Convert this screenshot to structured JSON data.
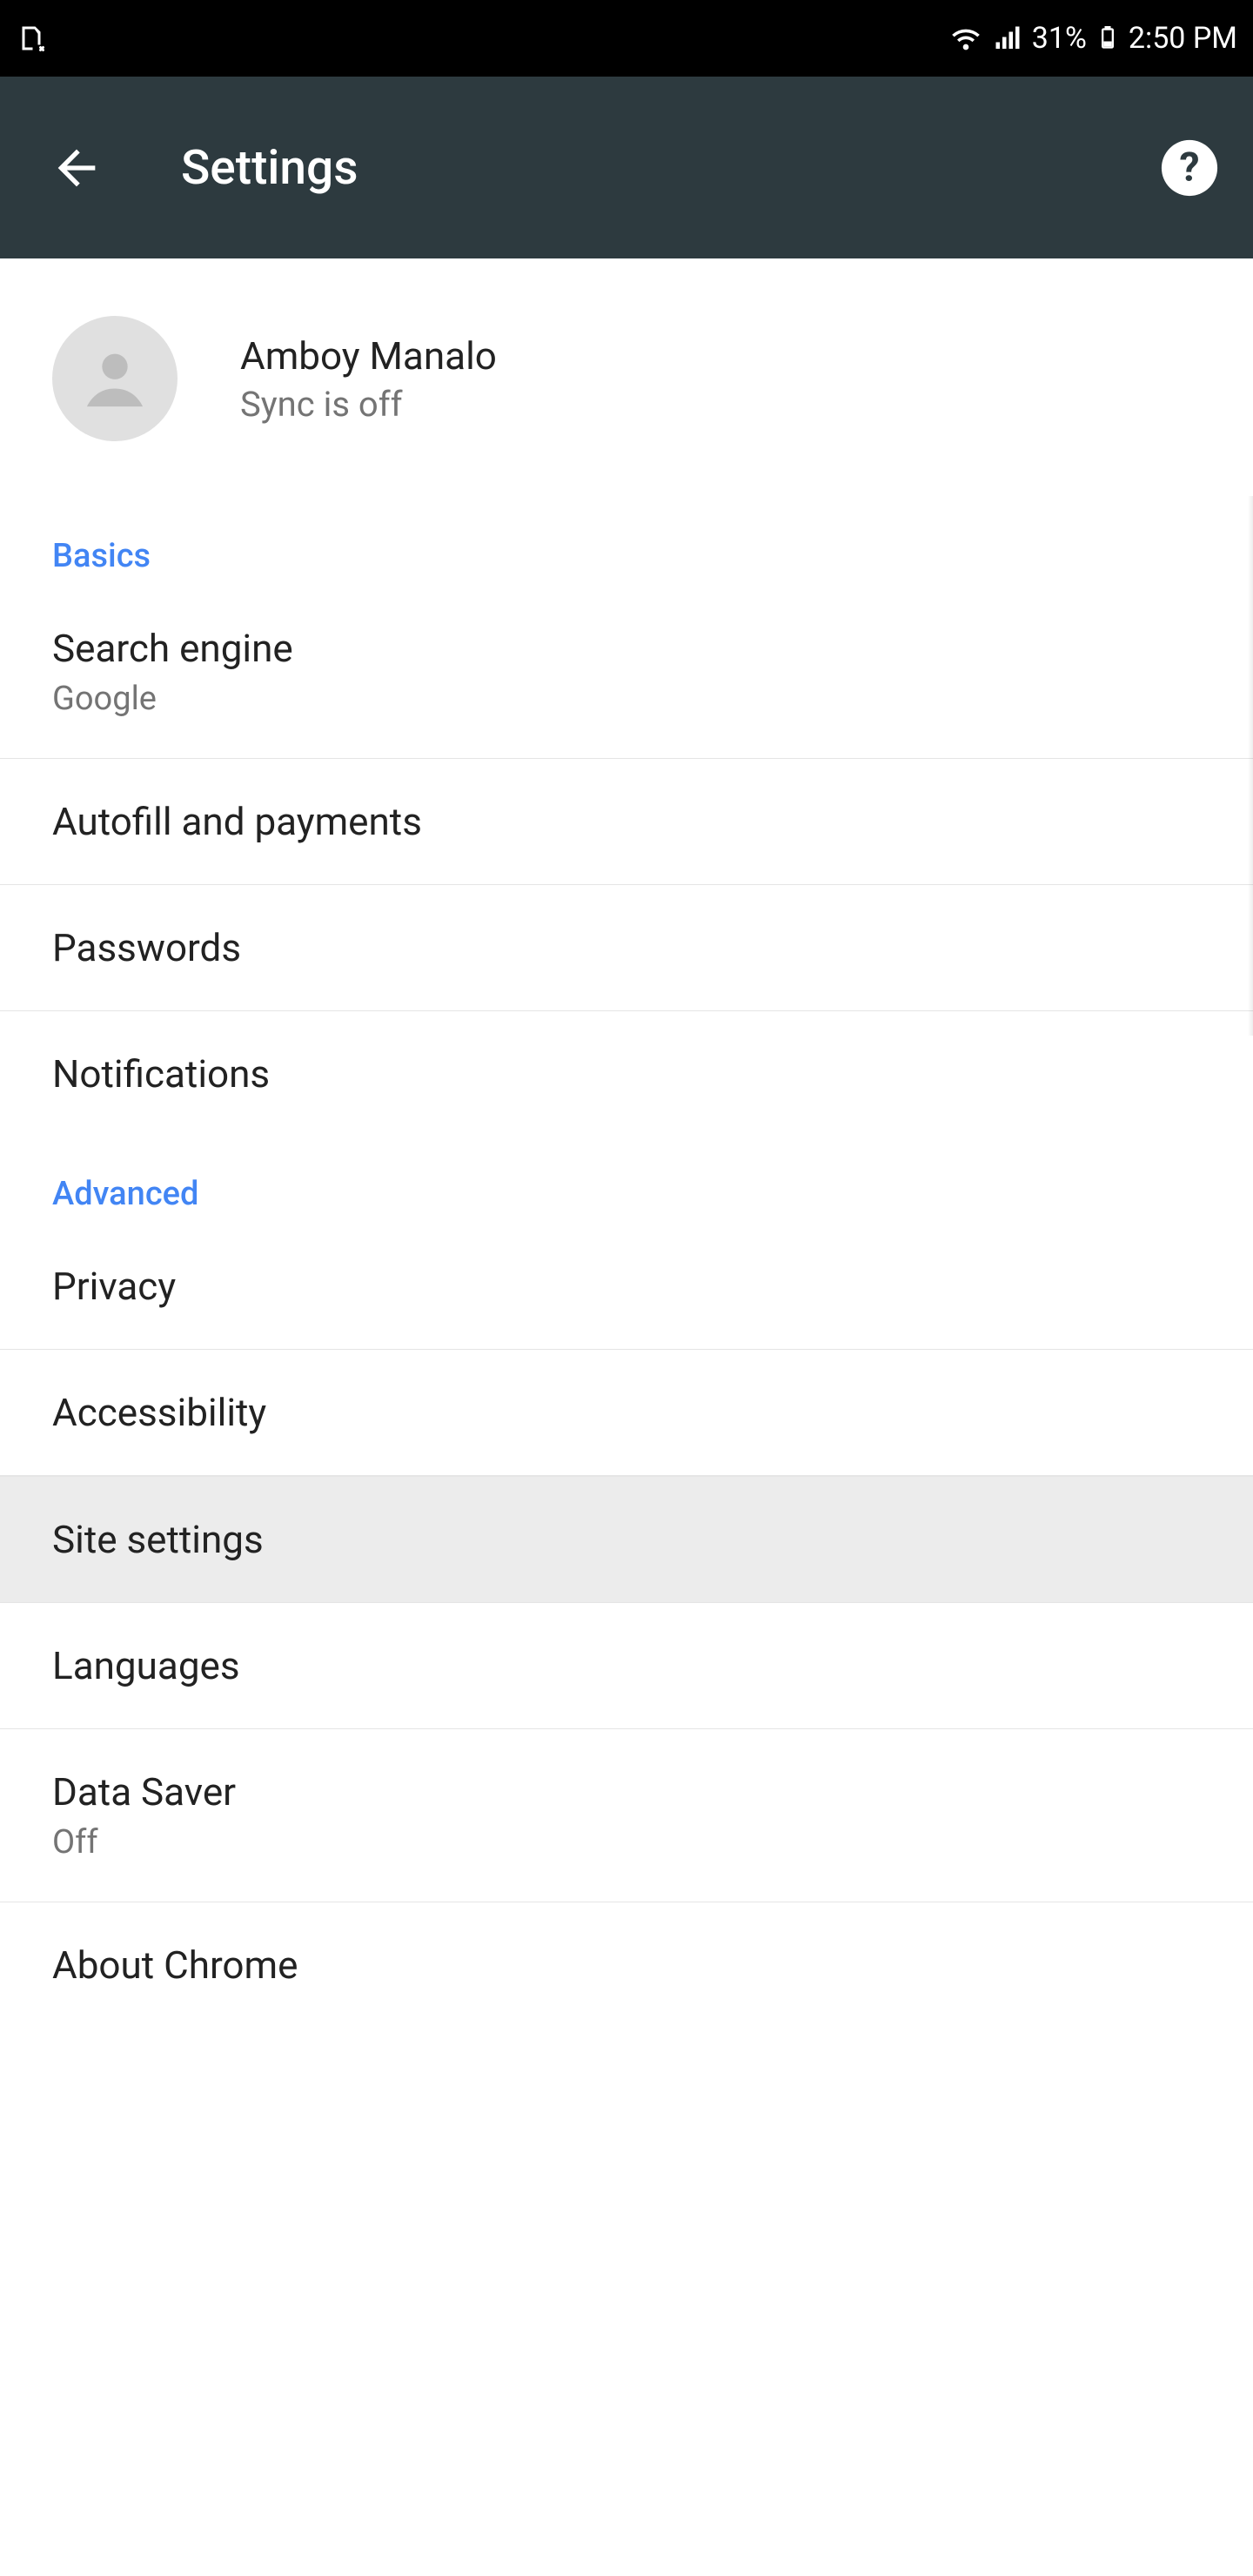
{
  "status": {
    "battery": "31%",
    "time": "2:50 PM"
  },
  "appbar": {
    "title": "Settings"
  },
  "account": {
    "name": "Amboy Manalo",
    "sync": "Sync is off"
  },
  "sections": {
    "basics": {
      "label": "Basics",
      "items": {
        "search_engine": {
          "title": "Search engine",
          "sub": "Google"
        },
        "autofill": {
          "title": "Autofill and payments"
        },
        "passwords": {
          "title": "Passwords"
        },
        "notifications": {
          "title": "Notifications"
        }
      }
    },
    "advanced": {
      "label": "Advanced",
      "items": {
        "privacy": {
          "title": "Privacy"
        },
        "accessibility": {
          "title": "Accessibility"
        },
        "site_settings": {
          "title": "Site settings"
        },
        "languages": {
          "title": "Languages"
        },
        "data_saver": {
          "title": "Data Saver",
          "sub": "Off"
        },
        "about": {
          "title": "About Chrome"
        }
      }
    }
  }
}
